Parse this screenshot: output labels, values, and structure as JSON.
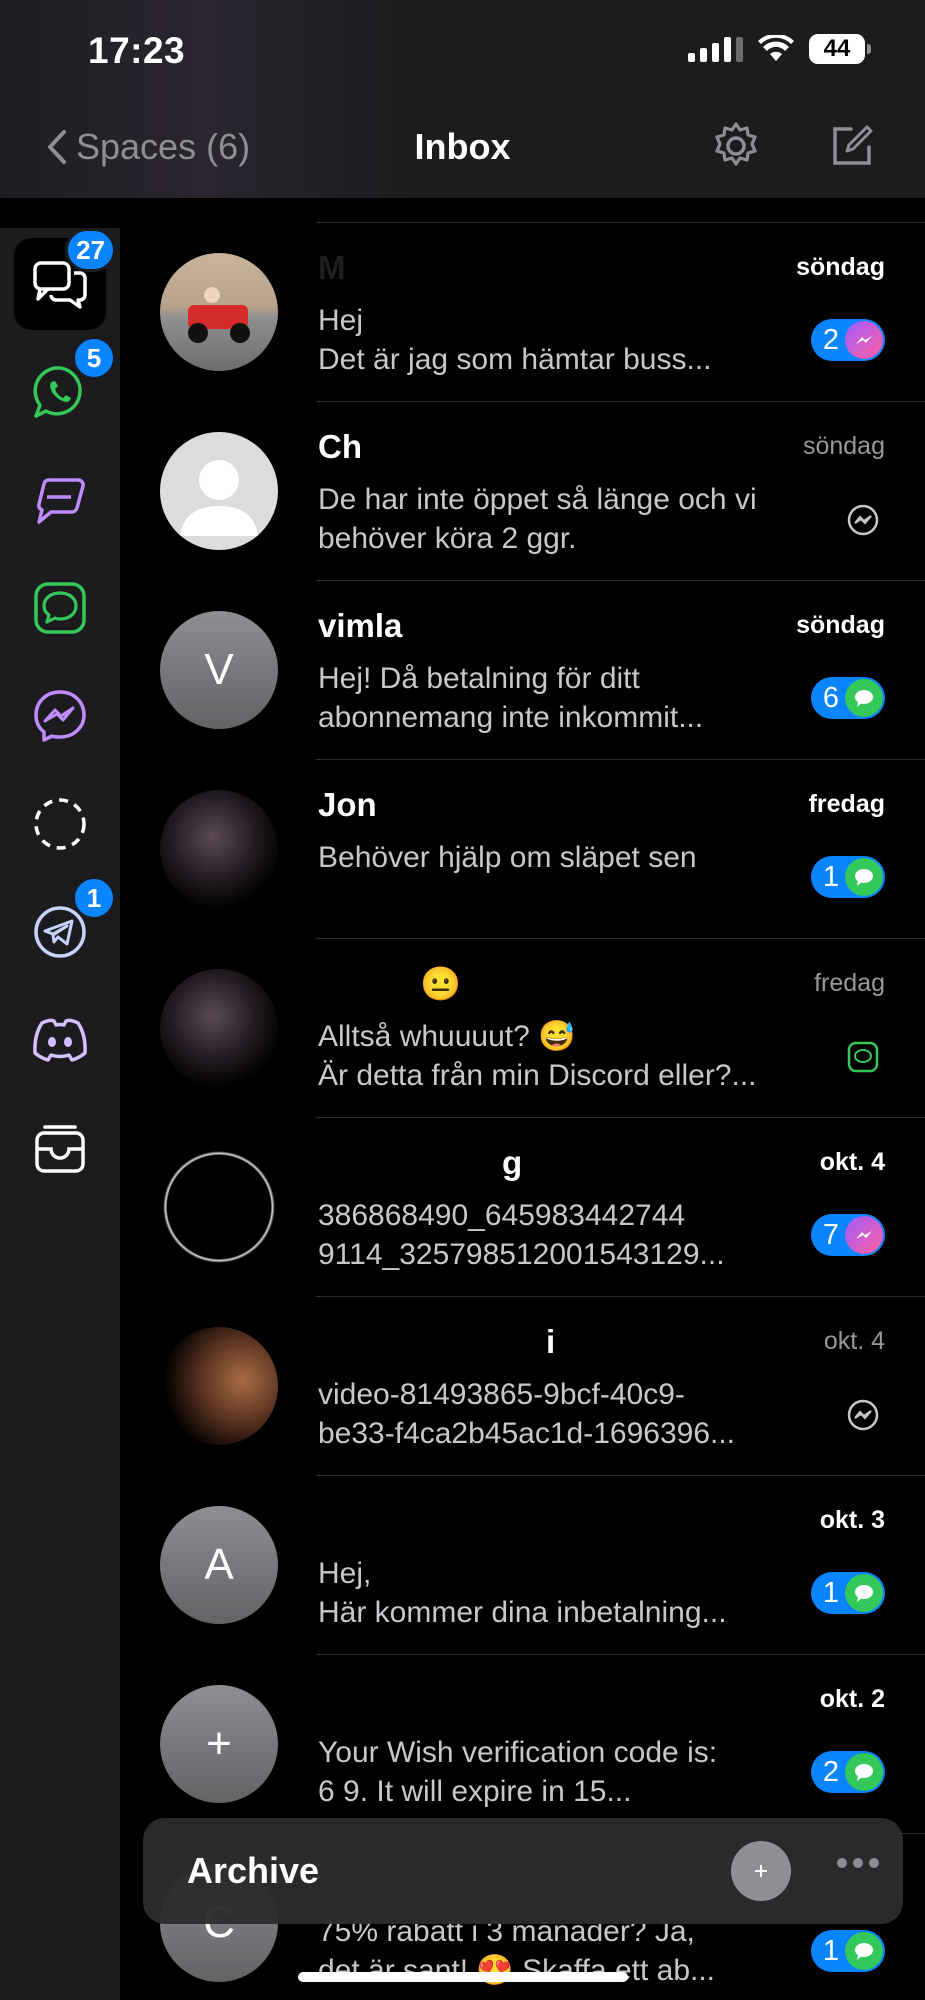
{
  "status": {
    "time": "17:23",
    "battery": "44"
  },
  "nav": {
    "back_label": "Spaces (6)",
    "title": "Inbox"
  },
  "sidebar": {
    "items": [
      {
        "name": "all-chats",
        "badge": "27",
        "active": true
      },
      {
        "name": "whatsapp",
        "badge": "5"
      },
      {
        "name": "beeper-chat"
      },
      {
        "name": "messages"
      },
      {
        "name": "messenger"
      },
      {
        "name": "placeholder-circle"
      },
      {
        "name": "telegram",
        "badge": "1"
      },
      {
        "name": "discord"
      },
      {
        "name": "archive-tray"
      }
    ]
  },
  "colors": {
    "accent": "#0a84ff",
    "messages_green": "#34c759",
    "messenger_purple": "#a05cff",
    "sidebar_bg": "#1c1c1e"
  },
  "conversations": [
    {
      "name": "M",
      "date": "söndag",
      "unread": true,
      "preview": "Hej\nDet är jag som hämtar buss...",
      "count": "2",
      "service": "messenger"
    },
    {
      "name": "Ch",
      "date": "söndag",
      "unread": false,
      "preview": "De har inte öppet så länge och vi\nbehöver köra 2 ggr.",
      "service": "messenger"
    },
    {
      "name": "vimla",
      "avatar_letter": "V",
      "date": "söndag",
      "unread": true,
      "preview": "Hej! Då betalning för ditt\nabonnemang inte inkommit...",
      "count": "6",
      "service": "messages"
    },
    {
      "name": "Jon",
      "date": "fredag",
      "unread": true,
      "preview": "Behöver hjälp om släpet sen",
      "count": "1",
      "service": "messages"
    },
    {
      "name": "😐",
      "date": "fredag",
      "unread": false,
      "preview": "Alltså whuuuut? 😅\nÄr detta från min Discord eller?...",
      "service": "messages"
    },
    {
      "name": "g",
      "date": "okt. 4",
      "unread": true,
      "preview": "386868490_645983442744\n9114_3257985120015431​29...",
      "count": "7",
      "service": "messenger"
    },
    {
      "name": "i",
      "date": "okt. 4",
      "unread": false,
      "preview": "video-81493865-9bcf-40c9-\nbe33-f4ca2b45ac1d-1696396...",
      "service": "messenger"
    },
    {
      "name": "",
      "avatar_letter": "A",
      "date": "okt. 3",
      "unread": true,
      "preview": "Hej,\nHär kommer dina inbetalning...",
      "count": "1",
      "service": "messages"
    },
    {
      "name": "",
      "avatar_letter": "+",
      "date": "okt. 2",
      "unread": true,
      "preview": "Your Wish verification code is:\n6 9. It will expire in 15...",
      "count": "2",
      "service": "messages"
    },
    {
      "name": "",
      "avatar_letter": "C",
      "date": "",
      "unread": true,
      "preview": "75% rabatt i 3 månader? Ja,\ndet är sant! 😍 Skaffa ett ab...",
      "count": "1",
      "service": "messages"
    }
  ],
  "archive": {
    "label": "Archive"
  }
}
